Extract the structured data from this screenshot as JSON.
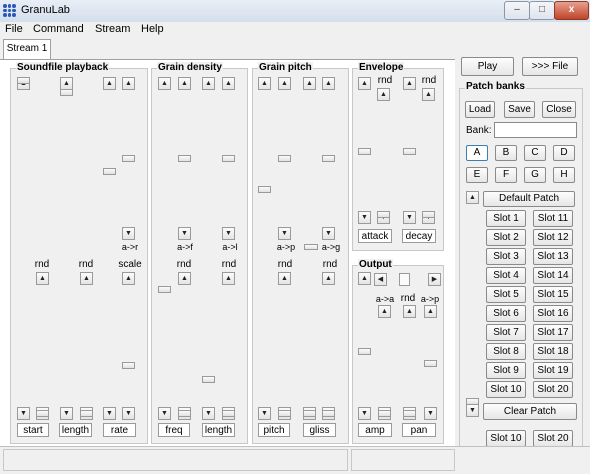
{
  "window": {
    "title": "GranuLab",
    "min": "–",
    "max": "□",
    "close": "x"
  },
  "menu": [
    "File",
    "Command",
    "Stream",
    "Help"
  ],
  "tabs": [
    "Stream 1"
  ],
  "groups": {
    "soundfile": {
      "title": "Soundfile playback",
      "labels": [
        "rnd",
        "rnd",
        "scale"
      ],
      "mid_toggle": "a->r",
      "bottom": [
        "start",
        "length",
        "rate"
      ]
    },
    "density": {
      "title": "Grain density",
      "labels": [
        "rnd",
        "rnd"
      ],
      "mid_toggles": [
        "a->f",
        "a->l"
      ],
      "bottom": [
        "freq",
        "length"
      ]
    },
    "pitch": {
      "title": "Grain pitch",
      "labels": [
        "rnd",
        "rnd"
      ],
      "mid_toggles": [
        "a->p",
        "a->g"
      ],
      "bottom": [
        "pitch",
        "gliss"
      ]
    },
    "envelope": {
      "title": "Envelope",
      "labels": [
        "rnd",
        "rnd"
      ],
      "bottom": [
        "attack",
        "decay"
      ]
    },
    "output": {
      "title": "Output",
      "labels": [
        "a->a",
        "rnd",
        "a->p"
      ],
      "bottom": [
        "amp",
        "pan"
      ]
    }
  },
  "transport": {
    "play": "Play",
    "to_file": ">>> File"
  },
  "patch": {
    "title": "Patch banks",
    "load": "Load",
    "save": "Save",
    "close": "Close",
    "bank_label": "Bank:",
    "bank_value": "",
    "banks": [
      "A",
      "B",
      "C",
      "D",
      "E",
      "F",
      "G",
      "H"
    ],
    "selected_bank": "A",
    "default_patch": "Default Patch",
    "slots": [
      "Slot 1",
      "Slot 11",
      "Slot 2",
      "Slot 12",
      "Slot 3",
      "Slot 13",
      "Slot 4",
      "Slot 14",
      "Slot 5",
      "Slot 15",
      "Slot 6",
      "Slot 16",
      "Slot 7",
      "Slot 17",
      "Slot 8",
      "Slot 18",
      "Slot 9",
      "Slot 19",
      "Slot 10",
      "Slot 20"
    ],
    "clear_patch": "Clear Patch",
    "extra_slots": [
      "Slot 10",
      "Slot 20"
    ]
  },
  "arrows": {
    "up": "▲",
    "down": "▼",
    "left": "◀",
    "right": "▶"
  }
}
